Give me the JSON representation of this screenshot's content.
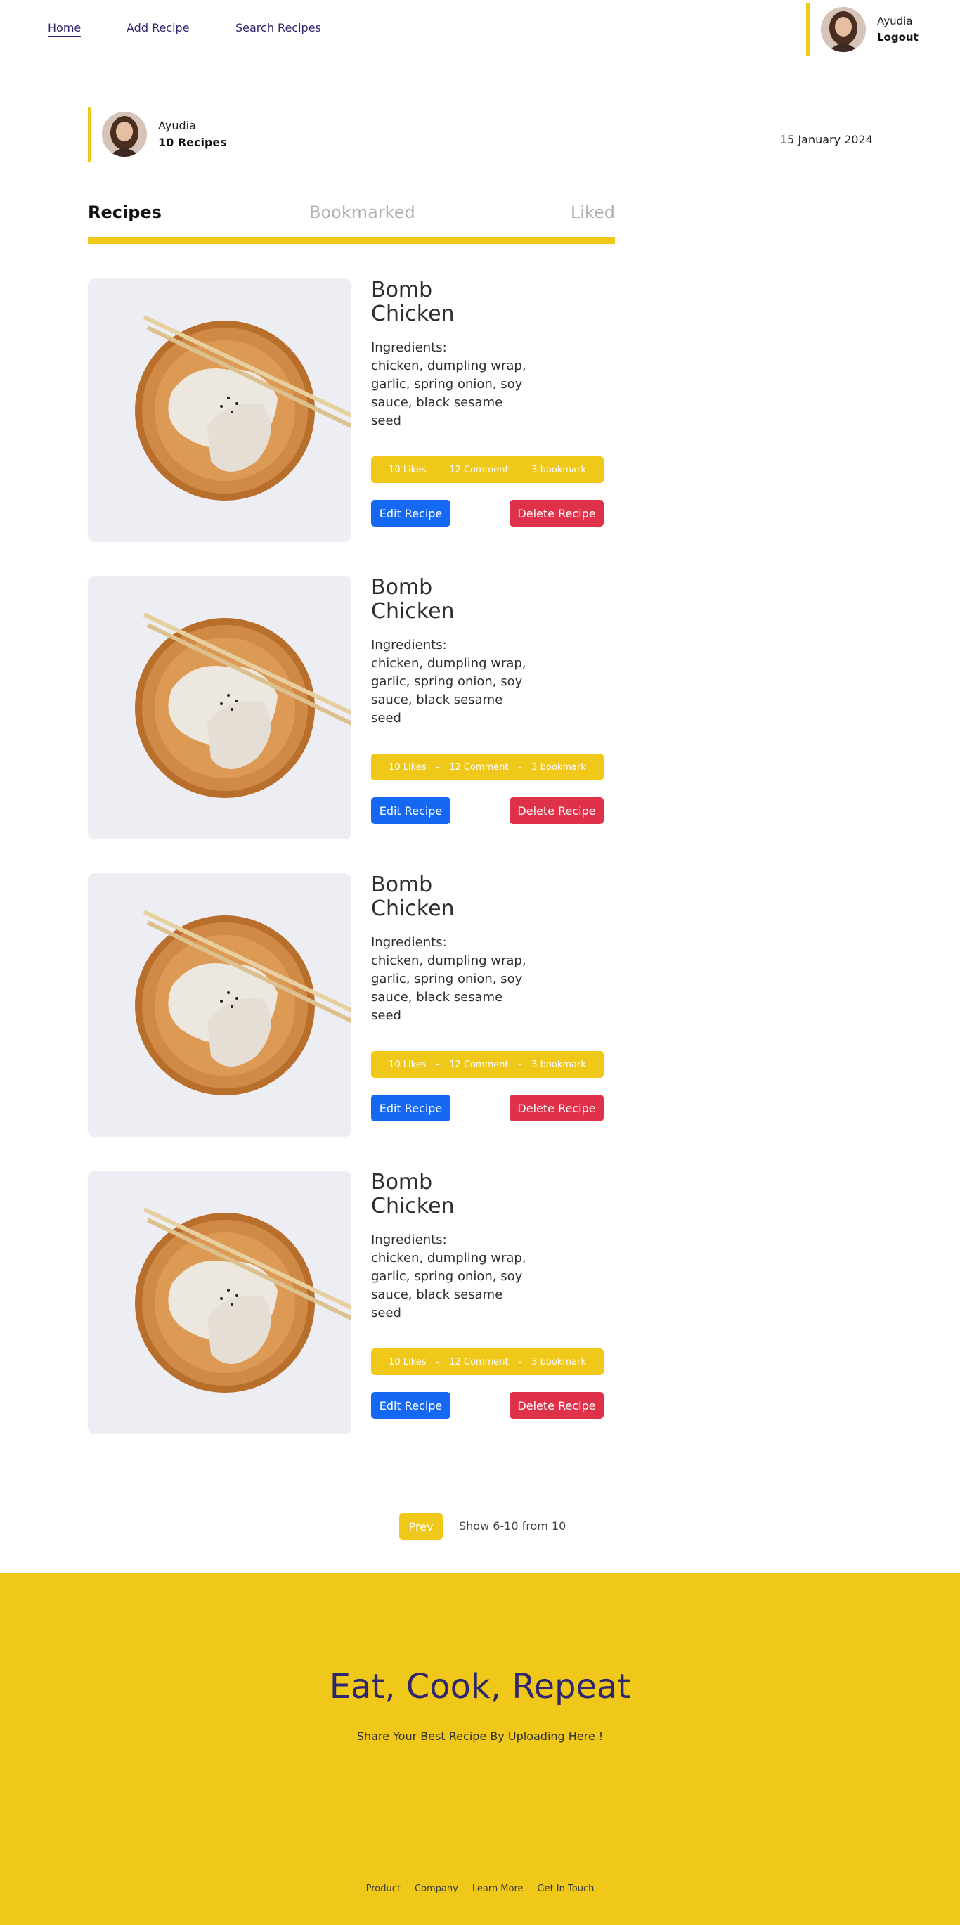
{
  "nav": {
    "links": [
      "Home",
      "Add Recipe",
      "Search Recipes"
    ],
    "user_name": "Ayudia",
    "logout_label": "Logout"
  },
  "profile": {
    "name": "Ayudia",
    "recipe_count": "10 Recipes",
    "date": "15 January 2024"
  },
  "tabs": [
    "Recipes",
    "Bookmarked",
    "Liked"
  ],
  "recipes": [
    {
      "title": "Bomb Chicken",
      "ingredients_label": "Ingredients:",
      "ingredients": "chicken, dumpling wrap, garlic, spring onion, soy sauce, black sesame seed",
      "likes": "10 Likes",
      "comments": "12 Comment",
      "bookmarks": "3 bookmark",
      "separator": "-",
      "edit_label": "Edit Recipe",
      "delete_label": "Delete Recipe"
    },
    {
      "title": "Bomb Chicken",
      "ingredients_label": "Ingredients:",
      "ingredients": "chicken, dumpling wrap, garlic, spring onion, soy sauce, black sesame seed",
      "likes": "10 Likes",
      "comments": "12 Comment",
      "bookmarks": "3 bookmark",
      "separator": "-",
      "edit_label": "Edit Recipe",
      "delete_label": "Delete Recipe"
    },
    {
      "title": "Bomb Chicken",
      "ingredients_label": "Ingredients:",
      "ingredients": "chicken, dumpling wrap, garlic, spring onion, soy sauce, black sesame seed",
      "likes": "10 Likes",
      "comments": "12 Comment",
      "bookmarks": "3 bookmark",
      "separator": "-",
      "edit_label": "Edit Recipe",
      "delete_label": "Delete Recipe"
    },
    {
      "title": "Bomb Chicken",
      "ingredients_label": "Ingredients:",
      "ingredients": "chicken, dumpling wrap, garlic, spring onion, soy sauce, black sesame seed",
      "likes": "10 Likes",
      "comments": "12 Comment",
      "bookmarks": "3 bookmark",
      "separator": "-",
      "edit_label": "Edit Recipe",
      "delete_label": "Delete Recipe"
    }
  ],
  "pagination": {
    "prev_label": "Prev",
    "info": "Show 6-10 from 10"
  },
  "footer": {
    "headline": "Eat, Cook, Repeat",
    "subtitle": "Share Your Best Recipe By Uploading Here !",
    "links": [
      "Product",
      "Company",
      "Learn More",
      "Get In Touch"
    ]
  },
  "colors": {
    "accent_yellow": "#efc81a",
    "brand_navy": "#2e266f",
    "edit_blue": "#1468f2",
    "delete_red": "#e0314a"
  },
  "icons": {
    "avatar": "user-avatar-photo",
    "recipe_photo": "dumpling-plate-photo"
  }
}
